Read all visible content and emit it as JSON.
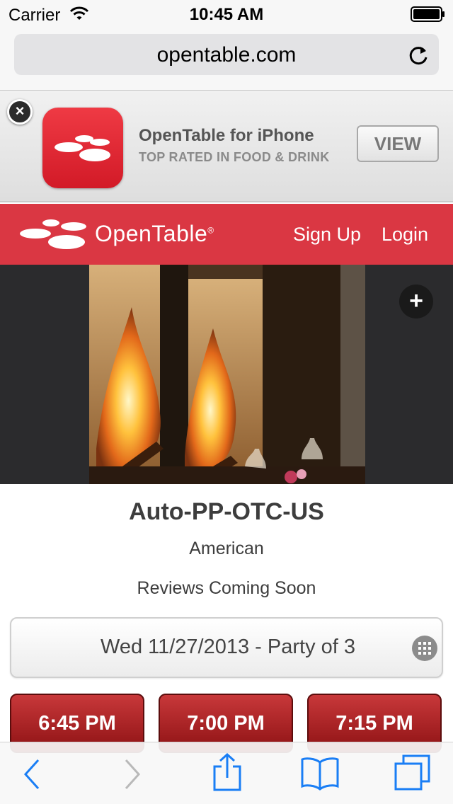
{
  "status_bar": {
    "carrier": "Carrier",
    "time": "10:45 AM"
  },
  "browser": {
    "url": "opentable.com"
  },
  "smart_banner": {
    "title": "OpenTable for iPhone",
    "subtitle": "TOP RATED IN FOOD & DRINK",
    "button_label": "VIEW",
    "close_symbol": "×"
  },
  "header": {
    "logo_text": "OpenTable",
    "logo_mark_suffix": "®",
    "sign_up": "Sign Up",
    "login": "Login",
    "brand_color": "#da3743"
  },
  "hero": {
    "add_symbol": "+"
  },
  "restaurant": {
    "name": "Auto-PP-OTC-US",
    "cuisine": "American",
    "reviews": "Reviews Coming Soon"
  },
  "reservation": {
    "summary": "Wed 11/27/2013 - Party of 3",
    "times": [
      "6:45 PM",
      "7:00 PM",
      "7:15 PM"
    ]
  },
  "toolbar": {
    "icons": [
      "back-icon",
      "forward-icon",
      "share-icon",
      "bookmarks-icon",
      "tabs-icon"
    ],
    "accent_color": "#1a7ef5"
  }
}
